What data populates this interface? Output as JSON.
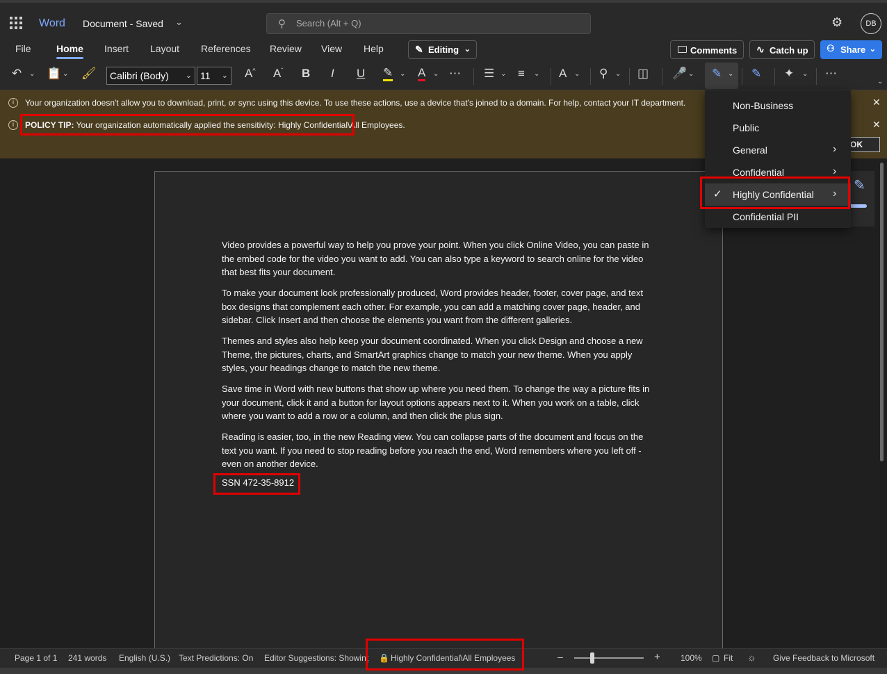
{
  "app": {
    "name": "Word",
    "doc_title": "Document - Saved",
    "user_initials": "DB"
  },
  "search": {
    "placeholder": "Search (Alt + Q)"
  },
  "tabs": [
    "File",
    "Home",
    "Insert",
    "Layout",
    "References",
    "Review",
    "View",
    "Help"
  ],
  "active_tab": "Home",
  "actions": {
    "editing": "Editing",
    "comments": "Comments",
    "catch_up": "Catch up",
    "share": "Share"
  },
  "ribbon": {
    "font_name": "Calibri (Body)",
    "font_size": "11"
  },
  "infobar": {
    "message": "Your organization doesn't allow you to download, print, or sync using this device. To use these actions, use a device that's joined to a domain. For help, contact your IT department.",
    "policy_label": "POLICY TIP:",
    "policy_text": "Your organization automatically applied the sensitivity: Highly Confidential\\All Employees.",
    "ok_label": "OK"
  },
  "document": {
    "paragraphs": [
      "Video provides a powerful way to help you prove your point. When you click Online Video, you can paste in the embed code for the video you want to add. You can also type a keyword to search online for the video that best fits your document.",
      "To make your document look professionally produced, Word provides header, footer, cover page, and text box designs that complement each other. For example, you can add a matching cover page, header, and sidebar. Click Insert and then choose the elements you want from the different galleries.",
      "Themes and styles also help keep your document coordinated. When you click Design and choose a new Theme, the pictures, charts, and SmartArt graphics change to match your new theme. When you apply styles, your headings change to match the new theme.",
      "Save time in Word with new buttons that show up where you need them. To change the way a picture fits in your document, click it and a button for layout options appears next to it. When you work on a table, click where you want to add a row or a column, and then click the plus sign.",
      "Reading is easier, too, in the new Reading view. You can collapse parts of the document and focus on the text you want. If you need to stop reading before you reach the end, Word remembers where you left off - even on another device."
    ],
    "ssn_line": "SSN 472-35-8912"
  },
  "sensitivity_menu": {
    "items": [
      {
        "label": "Non-Business",
        "submenu": false,
        "checked": false
      },
      {
        "label": "Public",
        "submenu": false,
        "checked": false
      },
      {
        "label": "General",
        "submenu": true,
        "checked": false
      },
      {
        "label": "Confidential",
        "submenu": true,
        "checked": false
      },
      {
        "label": "Highly Confidential",
        "submenu": true,
        "checked": true
      },
      {
        "label": "Confidential PII",
        "submenu": false,
        "checked": false
      }
    ]
  },
  "status": {
    "page": "Page 1 of 1",
    "words": "241 words",
    "language": "English (U.S.)",
    "text_predictions": "Text Predictions: On",
    "editor_suggestions": "Editor Suggestions: Showing",
    "sensitivity": "Highly Confidential\\All Employees",
    "zoom": "100%",
    "fit": "Fit",
    "feedback": "Give Feedback to Microsoft"
  },
  "colors": {
    "accent": "#7fa8ff",
    "share_button": "#2f78e6",
    "infobar_bg": "#4a3d1f",
    "highlight": "#e00000"
  }
}
